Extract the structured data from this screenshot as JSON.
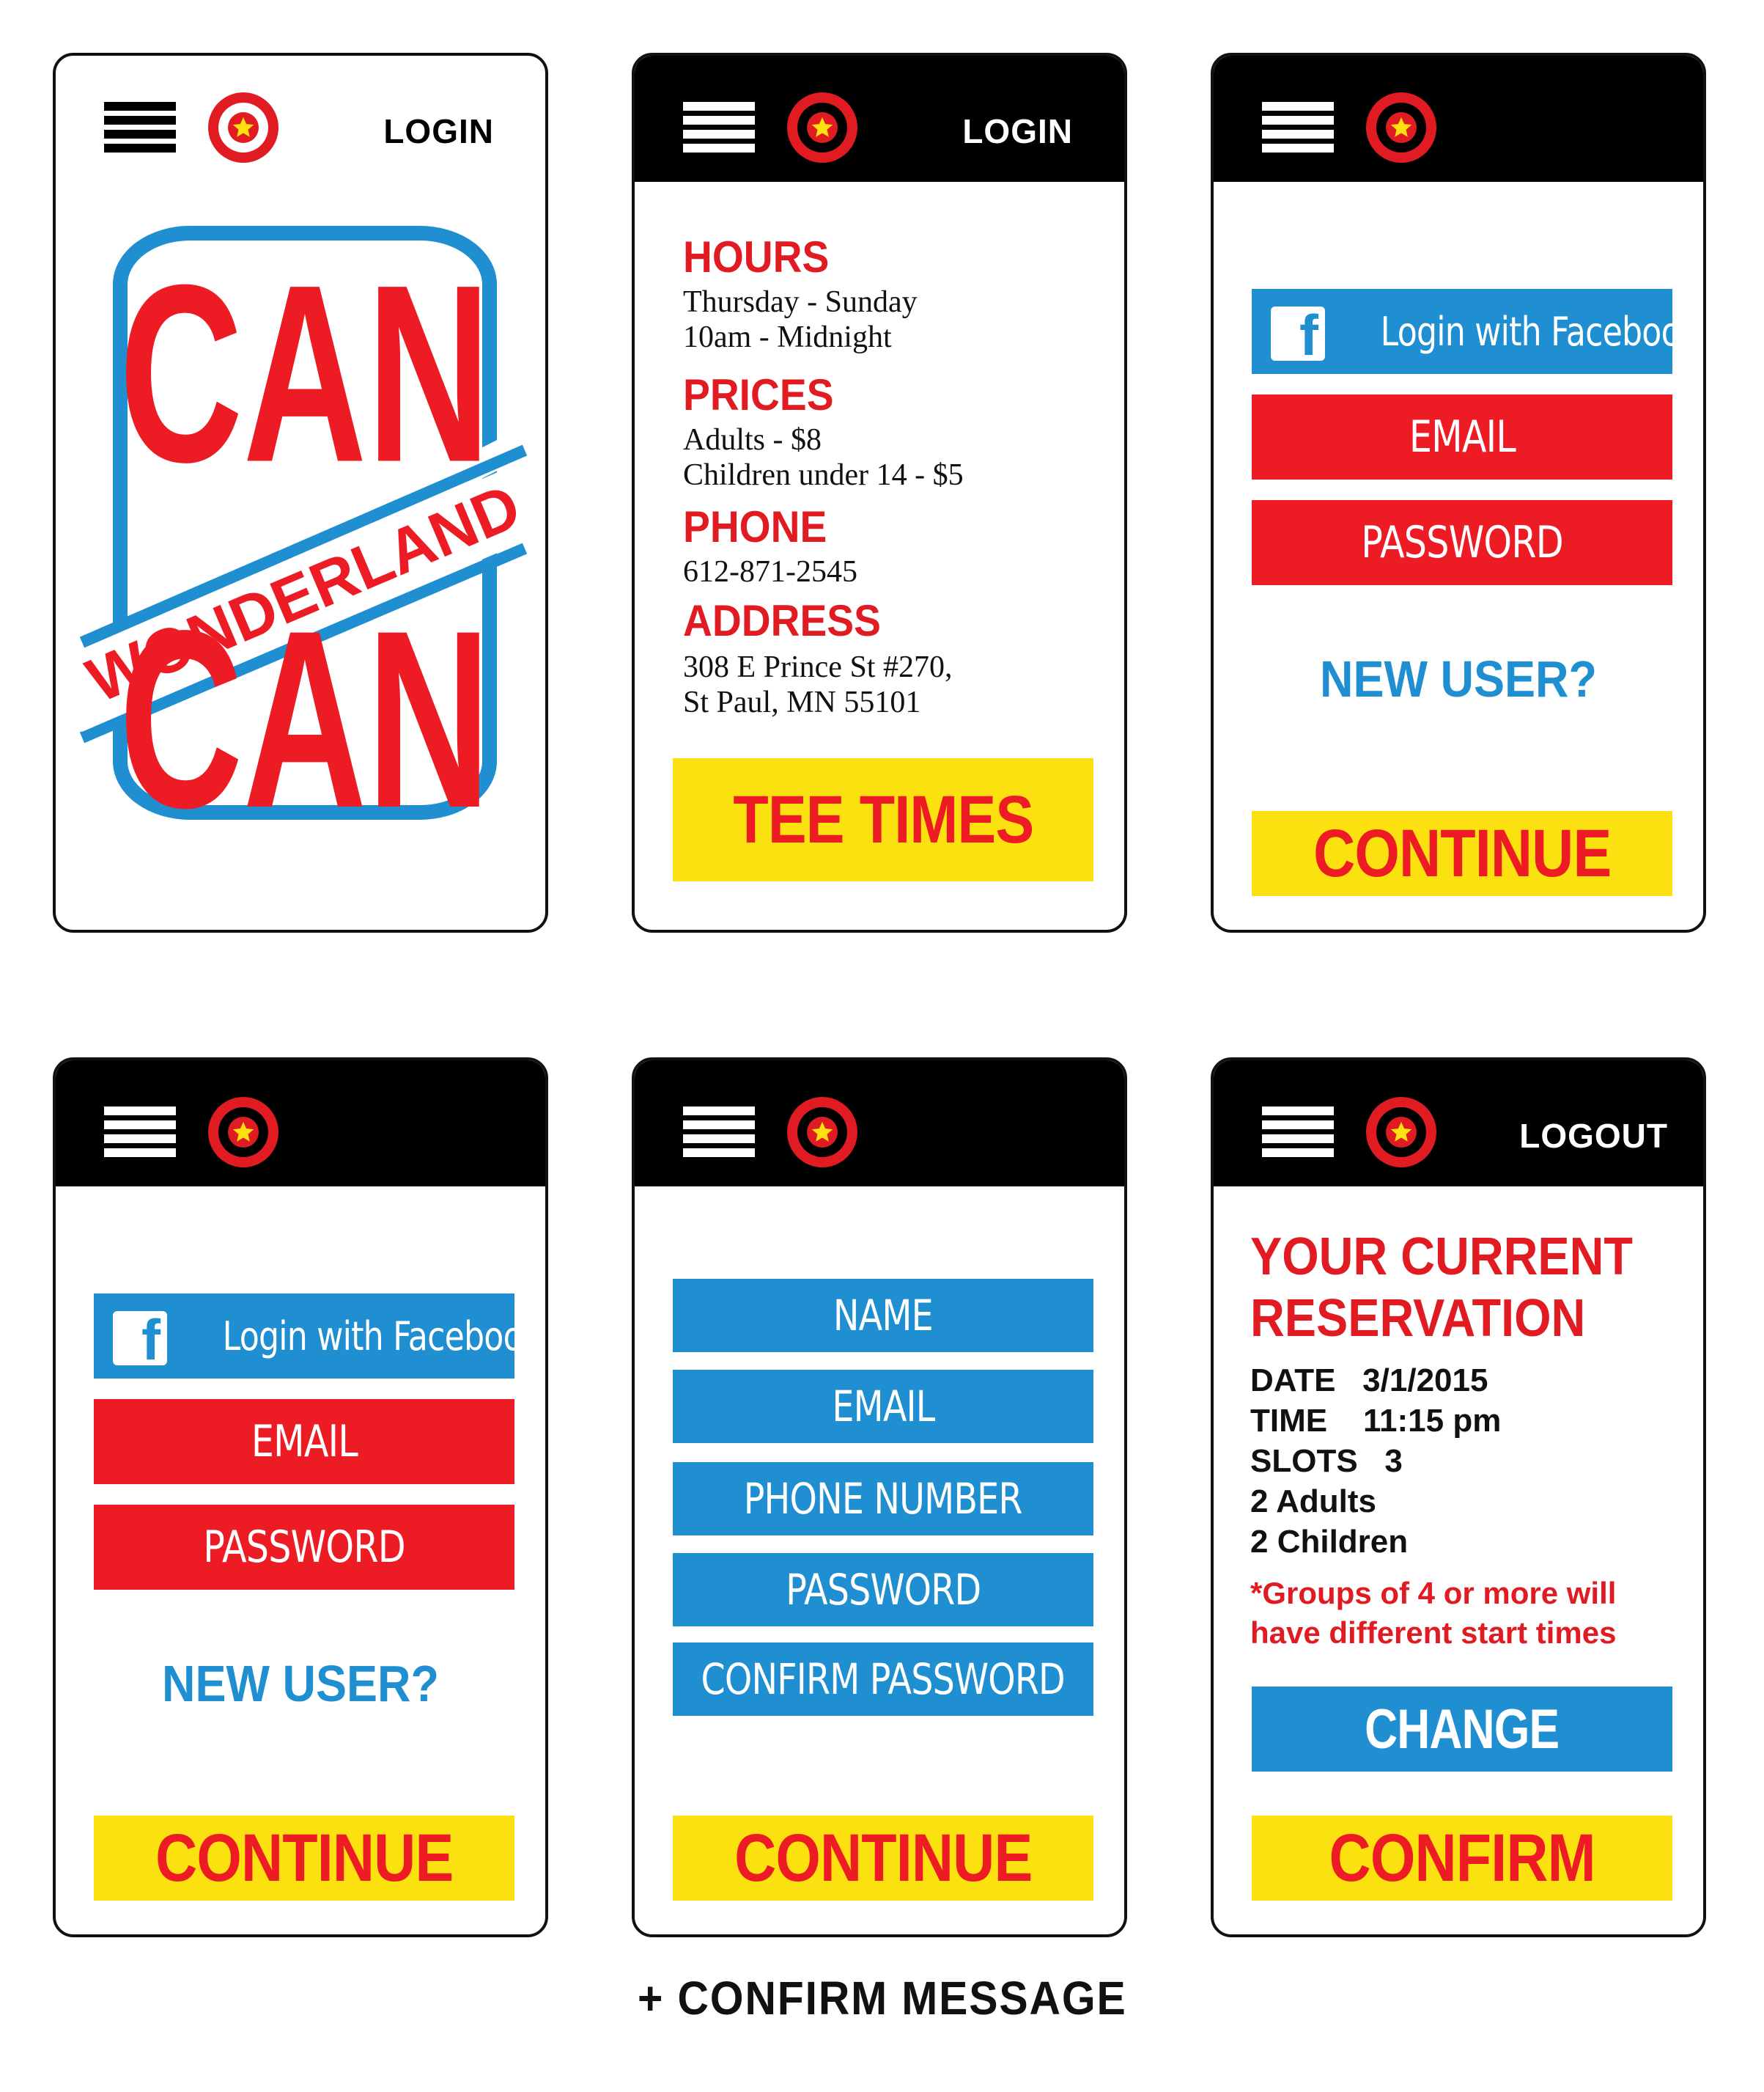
{
  "colors": {
    "red": "#ed1c24",
    "blue": "#1f8fd1",
    "yellow": "#fbe10f",
    "black": "#000000"
  },
  "screen1": {
    "top_link": "LOGIN",
    "logo": {
      "line1": "CAN",
      "band": "WONDERLAND",
      "line2": "CAN"
    }
  },
  "screen2": {
    "top_link": "LOGIN",
    "hours_label": "HOURS",
    "hours_text": "Thursday - Sunday\n10am - Midnight",
    "prices_label": "PRICES",
    "prices_text": "Adults - $8\nChildren under 14 - $5",
    "phone_label": "PHONE",
    "phone_text": "612-871-2545",
    "address_label": "ADDRESS",
    "address_text": "308 E Prince St #270,\nSt Paul, MN 55101",
    "tee_times_button": "TEE TIMES"
  },
  "screen3": {
    "facebook_button": "Login with Facebook",
    "facebook_icon": "facebook-icon",
    "email_field": "EMAIL",
    "password_field": "PASSWORD",
    "new_user_link": "NEW USER?",
    "continue_button": "CONTINUE"
  },
  "screen4": {
    "facebook_button": "Login with Facebook",
    "facebook_icon": "facebook-icon",
    "email_field": "EMAIL",
    "password_field": "PASSWORD",
    "new_user_link": "NEW USER?",
    "continue_button": "CONTINUE"
  },
  "screen5": {
    "name_field": "NAME",
    "email_field": "EMAIL",
    "phone_field": "PHONE NUMBER",
    "password_field": "PASSWORD",
    "confirm_password_field": "CONFIRM PASSWORD",
    "continue_button": "CONTINUE"
  },
  "screen6": {
    "top_link": "LOGOUT",
    "heading_line1": "YOUR CURRENT",
    "heading_line2": "RESERVATION",
    "date_row": "DATE   3/1/2015",
    "time_row": "TIME    11:15 pm",
    "slots_row": "SLOTS   3",
    "adults_row": "2 Adults",
    "children_row": "2 Children",
    "note": "*Groups of 4 or more will have different start times",
    "change_button": "CHANGE",
    "confirm_button": "CONFIRM"
  },
  "footer_note": "+ CONFIRM MESSAGE",
  "icons": {
    "menu": "hamburger-menu-icon",
    "logo": "star-logo-icon"
  }
}
